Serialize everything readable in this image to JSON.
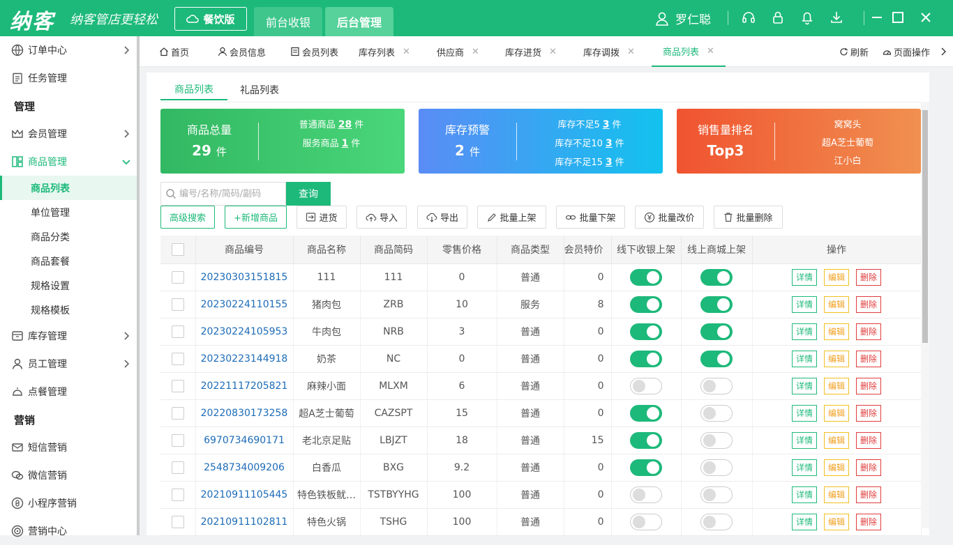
{
  "app": {
    "logo": "纳客",
    "slogan": "纳客管店更轻松",
    "edition": "餐饮版",
    "nav": [
      "前台收银",
      "后台管理"
    ],
    "user": "罗仁聪"
  },
  "sidebar": {
    "items": [
      {
        "label": "订单中心",
        "icon": "order-icon",
        "arrow": true
      },
      {
        "label": "任务管理",
        "icon": "task-icon",
        "arrow": false
      }
    ],
    "head_manage": "管理",
    "member": "会员管理",
    "goods": "商品管理",
    "goods_sub": [
      "商品列表",
      "单位管理",
      "商品分类",
      "商品套餐",
      "规格设置",
      "规格模板"
    ],
    "stock": "库存管理",
    "staff": "员工管理",
    "dish": "点餐管理",
    "head_marketing": "营销",
    "marketing": [
      "短信营销",
      "微信营销",
      "小程序营销",
      "营销中心"
    ]
  },
  "tabs": [
    {
      "label": "首页",
      "icon": "home-icon",
      "close": false
    },
    {
      "label": "会员信息",
      "icon": "user-icon",
      "close": false
    },
    {
      "label": "会员列表",
      "icon": "list-icon",
      "close": false
    },
    {
      "label": "库存列表",
      "close": true
    },
    {
      "label": "供应商",
      "close": true
    },
    {
      "label": "库存进货",
      "close": true
    },
    {
      "label": "库存调拨",
      "close": true
    },
    {
      "label": "商品列表",
      "close": true,
      "active": true
    }
  ],
  "tab_actions": {
    "refresh": "刷新",
    "page_ops": "页面操作"
  },
  "subtabs": [
    "商品列表",
    "礼品列表"
  ],
  "cards": {
    "total": {
      "title": "商品总量",
      "value": "29",
      "unit": "件",
      "lines": [
        {
          "label": "普通商品",
          "value": "28",
          "unit": "件"
        },
        {
          "label": "服务商品",
          "value": "1",
          "unit": "件"
        }
      ]
    },
    "warn": {
      "title": "库存预警",
      "value": "2",
      "unit": "件",
      "lines": [
        {
          "label": "库存不足5",
          "value": "3",
          "unit": "件"
        },
        {
          "label": "库存不足10",
          "value": "3",
          "unit": "件"
        },
        {
          "label": "库存不足15",
          "value": "3",
          "unit": "件"
        }
      ]
    },
    "rank": {
      "title": "销售量排名",
      "value": "Top3",
      "lines": [
        "窝窝头",
        "超A芝士葡萄",
        "江小白"
      ]
    }
  },
  "search": {
    "placeholder": "编号/名称/简码/副码",
    "button": "查询"
  },
  "toolbar": {
    "advanced": "高级搜索",
    "add": "+新增商品",
    "purchase": "进货",
    "import": "导入",
    "export": "导出",
    "batch_up": "批量上架",
    "batch_down": "批量下架",
    "batch_price": "批量改价",
    "batch_delete": "批量删除"
  },
  "table": {
    "headers": [
      "商品编号",
      "商品名称",
      "商品简码",
      "零售价格",
      "商品类型",
      "会员特价",
      "线下收银上架",
      "线上商城上架",
      "操作"
    ],
    "actions": {
      "detail": "详情",
      "edit": "编辑",
      "delete": "删除"
    },
    "rows": [
      {
        "code": "20230303151815",
        "name": "111",
        "short": "111",
        "price": "0",
        "type": "普通",
        "member": "0",
        "offline": true,
        "online": true
      },
      {
        "code": "20230224110155",
        "name": "猪肉包",
        "short": "ZRB",
        "price": "10",
        "type": "服务",
        "member": "8",
        "offline": true,
        "online": true
      },
      {
        "code": "20230224105953",
        "name": "牛肉包",
        "short": "NRB",
        "price": "3",
        "type": "普通",
        "member": "0",
        "offline": true,
        "online": true
      },
      {
        "code": "20230223144918",
        "name": "奶茶",
        "short": "NC",
        "price": "0",
        "type": "普通",
        "member": "0",
        "offline": true,
        "online": true
      },
      {
        "code": "20221117205821",
        "name": "麻辣小面",
        "short": "MLXM",
        "price": "6",
        "type": "普通",
        "member": "0",
        "offline": false,
        "online": false
      },
      {
        "code": "20220830173258",
        "name": "超A芝士葡萄",
        "short": "CAZSPT",
        "price": "15",
        "type": "普通",
        "member": "0",
        "offline": true,
        "online": false
      },
      {
        "code": "6970734690171",
        "name": "老北京足贴",
        "short": "LBJZT",
        "price": "18",
        "type": "普通",
        "member": "15",
        "offline": true,
        "online": false
      },
      {
        "code": "2548734009206",
        "name": "白香瓜",
        "short": "BXG",
        "price": "9.2",
        "type": "普通",
        "member": "0",
        "offline": true,
        "online": false
      },
      {
        "code": "20210911105445",
        "name": "特色铁板鱿…",
        "short": "TSTBYYHG",
        "price": "100",
        "type": "普通",
        "member": "0",
        "offline": false,
        "online": false
      },
      {
        "code": "20210911102811",
        "name": "特色火锅",
        "short": "TSHG",
        "price": "100",
        "type": "普通",
        "member": "0",
        "offline": false,
        "online": false
      }
    ]
  },
  "colors": {
    "brand": "#1db97a",
    "card_total": "#3bc06b",
    "card_warn": "#4fa3f7",
    "card_rank": "#f06a3a"
  }
}
